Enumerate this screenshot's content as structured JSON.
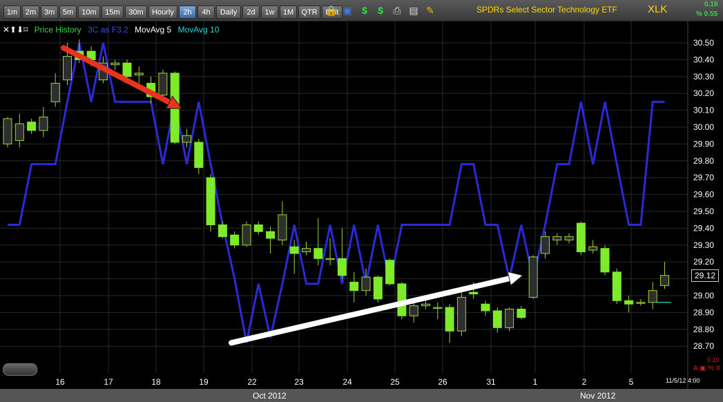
{
  "toolbar": {
    "timeframes": [
      "1m",
      "2m",
      "3m",
      "5m",
      "10m",
      "15m",
      "30m",
      "Hourly",
      "2h",
      "4h",
      "Daily",
      "2d",
      "1w",
      "1M",
      "QTR",
      "Edit"
    ],
    "active_timeframe": "2h"
  },
  "header": {
    "title": "SPDRs Select Sector Technology ETF",
    "ticker": "XLK",
    "change_top": "0.16",
    "change_bottom": "% 0.55"
  },
  "legend": {
    "icons": "✕⬆⬇⌑",
    "price_history": "Price History",
    "indicator": "3C as F3.2",
    "mov5": "MovAvg 5",
    "mov10": "MovAvg 10"
  },
  "footer": {
    "month_oct": "Oct 2012",
    "month_nov": "Nov 2012",
    "timestamp": "11/5/12 4:00",
    "scale_value": "0.10",
    "scale_controls": "A ▣ % X"
  },
  "last_price": "29.12",
  "colors": {
    "up": "#2e2e2e",
    "down": "#7dea2a",
    "indicator": "#2a2ad8",
    "grid": "#2a2a2a",
    "axis_text": "#ffffff",
    "red_arrow": "#e8331f",
    "white_arrow": "#ffffff",
    "ma_line": "#2fb89a"
  },
  "chart_data": {
    "type": "candlestick",
    "ylim": [
      28.6,
      30.58
    ],
    "yticks": [
      "30.50",
      "30.40",
      "30.30",
      "30.20",
      "30.10",
      "30.00",
      "29.90",
      "29.80",
      "29.70",
      "29.60",
      "29.50",
      "29.40",
      "29.30",
      "29.20",
      "29.10",
      "29.00",
      "28.90",
      "28.80",
      "28.70"
    ],
    "xticks": [
      "16",
      "17",
      "18",
      "19",
      "22",
      "23",
      "24",
      "25",
      "26",
      "31",
      "1",
      "2",
      "5"
    ],
    "candles": [
      {
        "o": 29.9,
        "c": 30.05,
        "h": 30.06,
        "l": 29.88
      },
      {
        "o": 29.92,
        "c": 30.02,
        "h": 30.08,
        "l": 29.88
      },
      {
        "o": 30.03,
        "c": 29.98,
        "h": 30.05,
        "l": 29.96
      },
      {
        "o": 29.98,
        "c": 30.06,
        "h": 30.12,
        "l": 29.94
      },
      {
        "o": 30.15,
        "c": 30.26,
        "h": 30.32,
        "l": 30.12
      },
      {
        "o": 30.28,
        "c": 30.42,
        "h": 30.5,
        "l": 30.25
      },
      {
        "o": 30.45,
        "c": 30.4,
        "h": 30.52,
        "l": 30.38
      },
      {
        "o": 30.45,
        "c": 30.4,
        "h": 30.48,
        "l": 30.36
      },
      {
        "o": 30.28,
        "c": 30.38,
        "h": 30.42,
        "l": 30.26
      },
      {
        "o": 30.37,
        "c": 30.38,
        "h": 30.4,
        "l": 30.34
      },
      {
        "o": 30.38,
        "c": 30.3,
        "h": 30.4,
        "l": 30.26
      },
      {
        "o": 30.31,
        "c": 30.32,
        "h": 30.36,
        "l": 30.26
      },
      {
        "o": 30.26,
        "c": 30.18,
        "h": 30.3,
        "l": 30.14
      },
      {
        "o": 30.19,
        "c": 30.32,
        "h": 30.34,
        "l": 30.16
      },
      {
        "o": 30.32,
        "c": 29.91,
        "h": 30.33,
        "l": 29.9
      },
      {
        "o": 29.91,
        "c": 29.95,
        "h": 29.99,
        "l": 29.88
      },
      {
        "o": 29.91,
        "c": 29.76,
        "h": 29.93,
        "l": 29.72
      },
      {
        "o": 29.7,
        "c": 29.42,
        "h": 29.72,
        "l": 29.38
      },
      {
        "o": 29.42,
        "c": 29.35,
        "h": 29.44,
        "l": 29.34
      },
      {
        "o": 29.36,
        "c": 29.3,
        "h": 29.38,
        "l": 29.28
      },
      {
        "o": 29.3,
        "c": 29.42,
        "h": 29.44,
        "l": 29.29
      },
      {
        "o": 29.42,
        "c": 29.38,
        "h": 29.44,
        "l": 29.36
      },
      {
        "o": 29.38,
        "c": 29.34,
        "h": 29.41,
        "l": 29.25
      },
      {
        "o": 29.33,
        "c": 29.48,
        "h": 29.56,
        "l": 29.3
      },
      {
        "o": 29.29,
        "c": 29.25,
        "h": 29.33,
        "l": 29.13
      },
      {
        "o": 29.26,
        "c": 29.28,
        "h": 29.32,
        "l": 29.24
      },
      {
        "o": 29.28,
        "c": 29.22,
        "h": 29.46,
        "l": 29.18
      },
      {
        "o": 29.22,
        "c": 29.22,
        "h": 29.34,
        "l": 29.18
      },
      {
        "o": 29.22,
        "c": 29.12,
        "h": 29.4,
        "l": 29.1
      },
      {
        "o": 29.08,
        "c": 29.03,
        "h": 29.14,
        "l": 28.96
      },
      {
        "o": 29.03,
        "c": 29.11,
        "h": 29.16,
        "l": 29.0
      },
      {
        "o": 29.11,
        "c": 28.98,
        "h": 29.12,
        "l": 28.96
      },
      {
        "o": 29.21,
        "c": 29.07,
        "h": 29.22,
        "l": 29.06
      },
      {
        "o": 29.07,
        "c": 28.88,
        "h": 29.08,
        "l": 28.86
      },
      {
        "o": 28.88,
        "c": 28.94,
        "h": 28.98,
        "l": 28.84
      },
      {
        "o": 28.94,
        "c": 28.95,
        "h": 28.98,
        "l": 28.92
      },
      {
        "o": 28.93,
        "c": 28.93,
        "h": 28.96,
        "l": 28.86
      },
      {
        "o": 28.93,
        "c": 28.79,
        "h": 28.95,
        "l": 28.72
      },
      {
        "o": 28.79,
        "c": 28.99,
        "h": 29.02,
        "l": 28.76
      },
      {
        "o": 29.02,
        "c": 29.01,
        "h": 29.08,
        "l": 28.98
      },
      {
        "o": 28.95,
        "c": 28.91,
        "h": 28.97,
        "l": 28.88
      },
      {
        "o": 28.91,
        "c": 28.81,
        "h": 28.93,
        "l": 28.78
      },
      {
        "o": 28.81,
        "c": 28.92,
        "h": 28.93,
        "l": 28.79
      },
      {
        "o": 28.92,
        "c": 28.87,
        "h": 28.94,
        "l": 28.86
      },
      {
        "o": 28.99,
        "c": 29.23,
        "h": 29.24,
        "l": 28.98
      },
      {
        "o": 29.25,
        "c": 29.35,
        "h": 29.38,
        "l": 29.22
      },
      {
        "o": 29.33,
        "c": 29.35,
        "h": 29.37,
        "l": 29.3
      },
      {
        "o": 29.33,
        "c": 29.35,
        "h": 29.37,
        "l": 29.31
      },
      {
        "o": 29.43,
        "c": 29.26,
        "h": 29.44,
        "l": 29.24
      },
      {
        "o": 29.27,
        "c": 29.29,
        "h": 29.33,
        "l": 29.25
      },
      {
        "o": 29.28,
        "c": 29.14,
        "h": 29.3,
        "l": 29.12
      },
      {
        "o": 29.14,
        "c": 28.97,
        "h": 29.16,
        "l": 28.95
      },
      {
        "o": 28.97,
        "c": 28.95,
        "h": 29.0,
        "l": 28.9
      },
      {
        "o": 28.96,
        "c": 28.96,
        "h": 28.98,
        "l": 28.94
      },
      {
        "o": 28.96,
        "c": 29.03,
        "h": 29.08,
        "l": 28.92
      },
      {
        "o": 29.06,
        "c": 29.12,
        "h": 29.2,
        "l": 29.04
      }
    ],
    "indicator_3c": [
      29.42,
      29.42,
      29.78,
      29.78,
      29.78,
      30.15,
      30.5,
      30.15,
      30.5,
      30.15,
      30.15,
      30.15,
      30.15,
      29.78,
      30.15,
      29.78,
      30.15,
      29.78,
      29.42,
      29.1,
      28.72,
      29.07,
      28.75,
      29.07,
      29.42,
      29.07,
      29.07,
      29.42,
      29.07,
      29.42,
      29.07,
      29.42,
      29.07,
      29.42,
      29.42,
      29.42,
      29.42,
      29.42,
      29.78,
      29.78,
      29.42,
      29.42,
      29.1,
      29.42,
      29.1,
      29.42,
      29.78,
      29.78,
      30.15,
      29.78,
      30.15,
      29.78,
      29.42,
      29.42,
      30.15,
      30.15
    ],
    "ma_line": [
      [
        951,
        28.96
      ],
      [
        972,
        28.96
      ]
    ],
    "annotations": {
      "red_arrow": [
        [
          92,
          30.47
        ],
        [
          263,
          30.11
        ]
      ],
      "white_arrow": [
        [
          335,
          28.72
        ],
        [
          757,
          29.12
        ]
      ]
    }
  }
}
